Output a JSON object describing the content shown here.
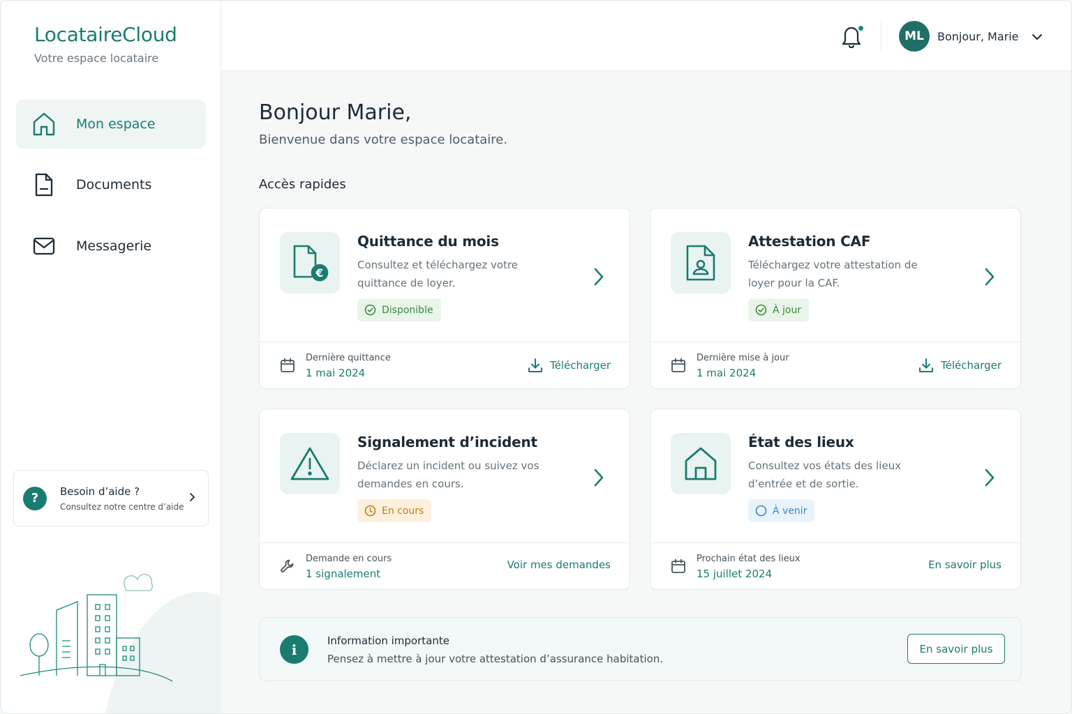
{
  "brand": {
    "name": "LocataireCloud",
    "tagline": "Votre espace locataire"
  },
  "nav": [
    {
      "label": "Mon espace",
      "icon": "home-icon",
      "active": true
    },
    {
      "label": "Documents",
      "icon": "document-icon",
      "active": false
    },
    {
      "label": "Messagerie",
      "icon": "mail-icon",
      "active": false
    }
  ],
  "help": {
    "title": "Besoin d’aide ?",
    "subtitle": "Consultez notre centre d’aide"
  },
  "header": {
    "user_initials": "ML",
    "user_greeting": "Bonjour, Marie"
  },
  "main": {
    "greeting": "Bonjour Marie,",
    "welcome": "Bienvenue dans votre espace locataire.",
    "section_title": "Accès rapides"
  },
  "cards": [
    {
      "title": "Quittance du mois",
      "description": "Consultez et téléchargez votre quittance de loyer.",
      "badge": "Disponible",
      "badge_color": "#3c8a3c",
      "icon": "receipt-euro-icon",
      "footer_label": "Dernière quittance",
      "footer_value": "1 mai 2024",
      "action": "Télécharger"
    },
    {
      "title": "Attestation CAF",
      "description": "Téléchargez votre attestation de loyer pour la CAF.",
      "badge": "À jour",
      "badge_color": "#3c8a3c",
      "icon": "id-document-icon",
      "footer_label": "Dernière mise à jour",
      "footer_value": "1 mai 2024",
      "action": "Télécharger"
    },
    {
      "title": "Signalement d’incident",
      "description": "Déclarez un incident ou suivez vos demandes en cours.",
      "badge": "En cours",
      "badge_color": "#c47a14",
      "icon": "warning-icon",
      "footer_label": "Demande en cours",
      "footer_value": "1 signalement",
      "action": "Voir mes demandes"
    },
    {
      "title": "État des lieux",
      "description": "Consultez vos états des lieux d’entrée et de sortie.",
      "badge": "À venir",
      "badge_color": "#3b88c2",
      "icon": "house-icon",
      "footer_label": "Prochain état des lieux",
      "footer_value": "15 juillet 2024",
      "action": "En savoir plus"
    }
  ],
  "info": {
    "title": "Information importante",
    "text": "Pensez à mettre à jour votre attestation d’assurance habitation.",
    "button": "En savoir plus"
  },
  "colors": {
    "accent": "#1a7c70",
    "avatar": "#1f6f66"
  }
}
